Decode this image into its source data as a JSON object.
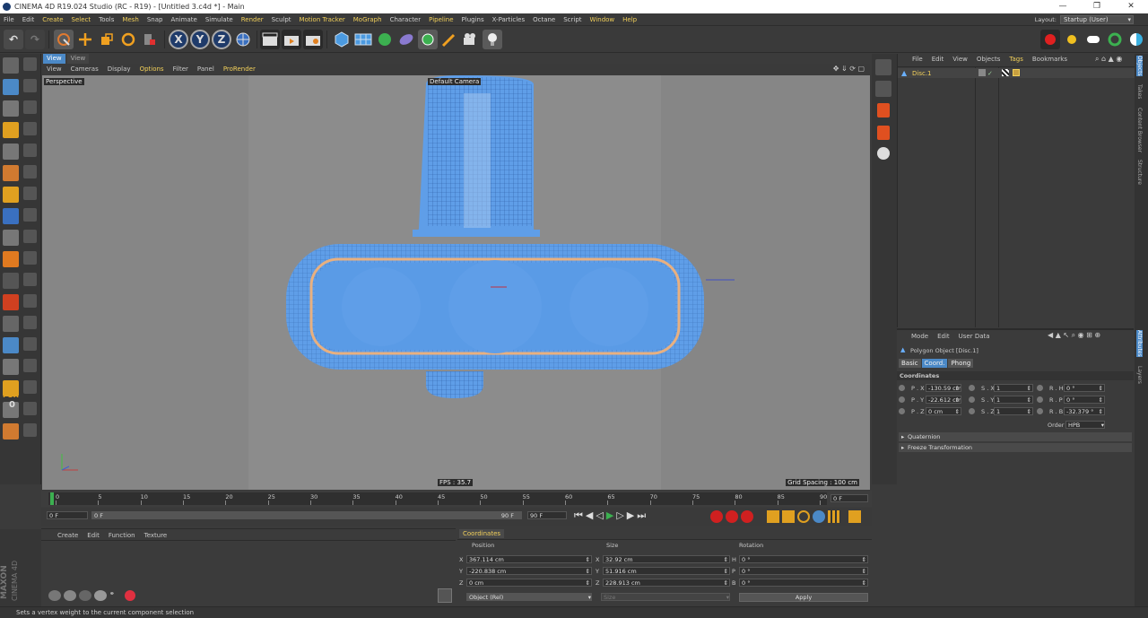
{
  "window": {
    "title": "CINEMA 4D R19.024 Studio (RC - R19) - [Untitled 3.c4d *] - Main",
    "minimize": "—",
    "restore": "❐",
    "close": "✕"
  },
  "menu": {
    "items": [
      "File",
      "Edit",
      "Create",
      "Select",
      "Tools",
      "Mesh",
      "Snap",
      "Animate",
      "Simulate",
      "Render",
      "Sculpt",
      "Motion Tracker",
      "MoGraph",
      "Character",
      "Pipeline",
      "Plugins",
      "X-Particles",
      "Octane",
      "Script",
      "Window",
      "Help"
    ],
    "highlighted": [
      "Create",
      "Select",
      "Mesh",
      "Render",
      "Motion Tracker",
      "MoGraph",
      "Pipeline",
      "Window",
      "Help"
    ],
    "layout_label": "Layout:",
    "layout_value": "Startup (User)"
  },
  "toolbar": {
    "x": "X",
    "y": "Y",
    "z": "Z",
    "undo": "↶",
    "redo": "↷"
  },
  "viewport": {
    "menu": [
      "View",
      "Cameras",
      "Display",
      "Options",
      "Filter",
      "Panel",
      "ProRender"
    ],
    "menu_highlighted": [
      "Options",
      "ProRender"
    ],
    "tabs": [
      "View",
      "View"
    ],
    "label": "Perspective",
    "camera": "Default Camera",
    "fps": "FPS : 35.7",
    "grid": "Grid Spacing : 100 cm"
  },
  "timeline": {
    "ticks": [
      "0",
      "5",
      "10",
      "15",
      "20",
      "25",
      "30",
      "35",
      "40",
      "45",
      "50",
      "55",
      "60",
      "65",
      "70",
      "75",
      "80",
      "85",
      "90"
    ],
    "current": "0 F",
    "start": "0 F",
    "start2": "0 F",
    "end": "90 F",
    "end2": "90 F"
  },
  "materials": {
    "menu": [
      "Create",
      "Edit",
      "Function",
      "Texture"
    ]
  },
  "coordinates": {
    "tab": "Coordinates",
    "headers": [
      "Position",
      "Size",
      "Rotation"
    ],
    "rows": [
      {
        "axis": "X",
        "pos": "367.114 cm",
        "saxis": "X",
        "size": "32.92 cm",
        "raxis": "H",
        "rot": "0 °"
      },
      {
        "axis": "Y",
        "pos": "-220.838 cm",
        "saxis": "Y",
        "size": "51.916 cm",
        "raxis": "P",
        "rot": "0 °"
      },
      {
        "axis": "Z",
        "pos": "0 cm",
        "saxis": "Z",
        "size": "228.913 cm",
        "raxis": "B",
        "rot": "0 °"
      }
    ],
    "mode": "Object (Rel)",
    "size_mode": "Size",
    "apply": "Apply"
  },
  "objects": {
    "menu": [
      "File",
      "Edit",
      "View",
      "Objects",
      "Tags",
      "Bookmarks"
    ],
    "menu_highlighted": [
      "Tags"
    ],
    "items": [
      {
        "name": "Disc.1"
      }
    ]
  },
  "attributes": {
    "menu": [
      "Mode",
      "Edit",
      "User Data"
    ],
    "object": "Polygon Object [Disc.1]",
    "tabs": [
      "Basic",
      "Coord.",
      "Phong"
    ],
    "active_tab": "Coord.",
    "section": "Coordinates",
    "rows": [
      {
        "pl": "P . X",
        "pv": "-130.59 cm",
        "sl": "S . X",
        "sv": "1",
        "rl": "R . H",
        "rv": "0 °"
      },
      {
        "pl": "P . Y",
        "pv": "-22.612 cm",
        "sl": "S . Y",
        "sv": "1",
        "rl": "R . P",
        "rv": "0 °"
      },
      {
        "pl": "P . Z",
        "pv": "0 cm",
        "sl": "S . Z",
        "sv": "1",
        "rl": "R . B",
        "rv": "-32.379 °"
      }
    ],
    "order_label": "Order",
    "order_value": "HPB",
    "sections": [
      "Quaternion",
      "Freeze Transformation"
    ]
  },
  "side_tabs": [
    "Objects",
    "Takes",
    "Content Browser",
    "Structure"
  ],
  "side_tabs_lower": [
    "Attributes",
    "Layers"
  ],
  "brand": {
    "top": "MAXON",
    "bottom": "CINEMA 4D"
  },
  "status": "Sets a vertex weight to the current component selection",
  "left_labels": {
    "psr": "PSR",
    "zero": "0"
  },
  "colors": {
    "accent": "#4b89c7",
    "highlight": "#f2d05a",
    "mesh": "#5f9ee8"
  }
}
